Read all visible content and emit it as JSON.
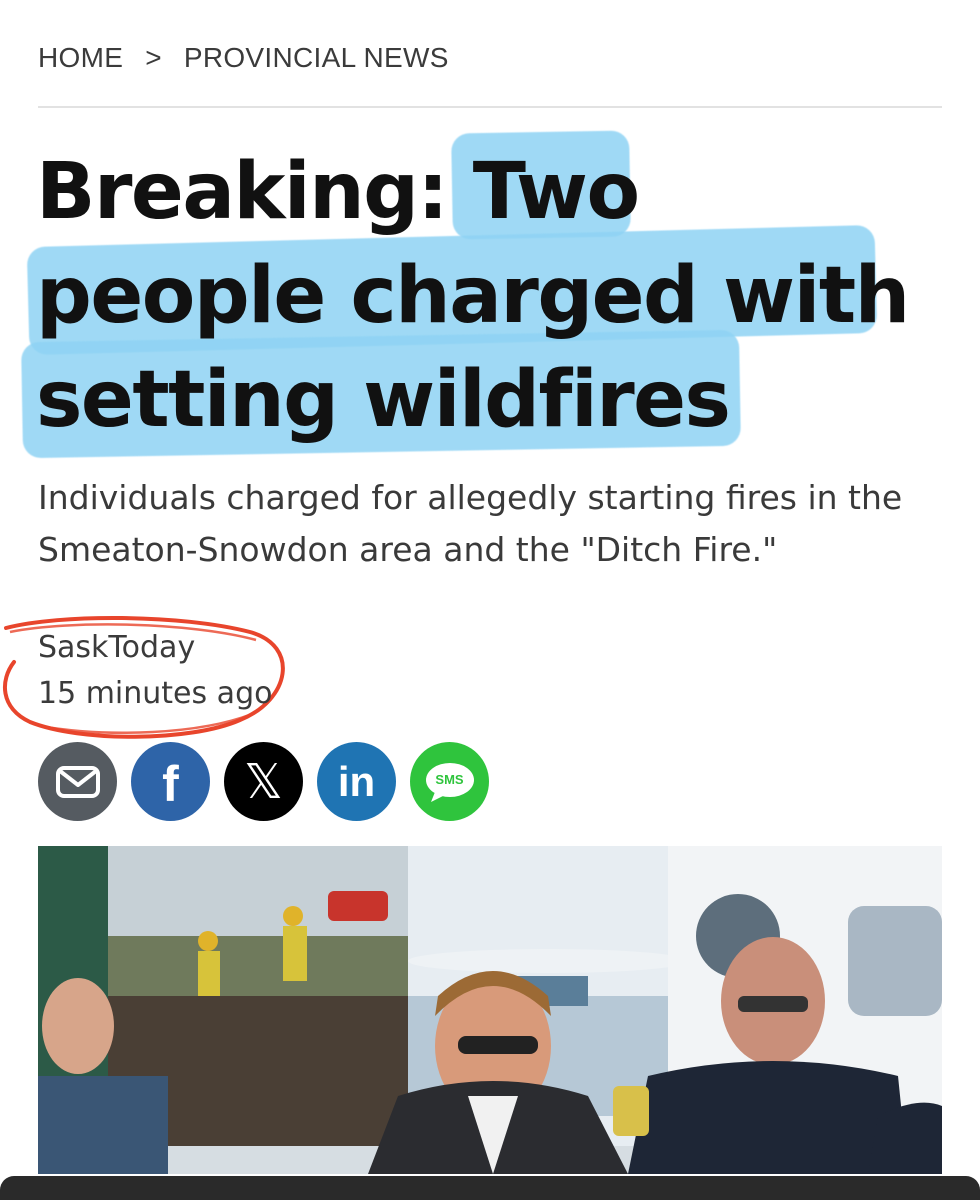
{
  "breadcrumb": {
    "home": "HOME",
    "separator": ">",
    "section": "PROVINCIAL NEWS"
  },
  "article": {
    "headline_line1": "Breaking: Two",
    "headline_line2": "people charged with",
    "headline_line3": "setting wildfires",
    "subtitle": "Individuals charged for allegedly starting fires in the Smeaton-Snowdon area and the \"Ditch Fire.\"",
    "author": "SaskToday",
    "published": "15 minutes ago"
  },
  "share": {
    "buttons": [
      {
        "icon": "email-icon",
        "color": "#555b61"
      },
      {
        "icon": "facebook-icon",
        "label": "f",
        "color": "#2e64a8"
      },
      {
        "icon": "x-icon",
        "label": "𝕏",
        "color": "#000000"
      },
      {
        "icon": "linkedin-icon",
        "label": "in",
        "color": "#1f74b3"
      },
      {
        "icon": "sms-icon",
        "label": "SMS",
        "color": "#2fc43d"
      }
    ]
  },
  "colors": {
    "highlight": "#8fd3f4",
    "annotation": "#e8452c"
  }
}
